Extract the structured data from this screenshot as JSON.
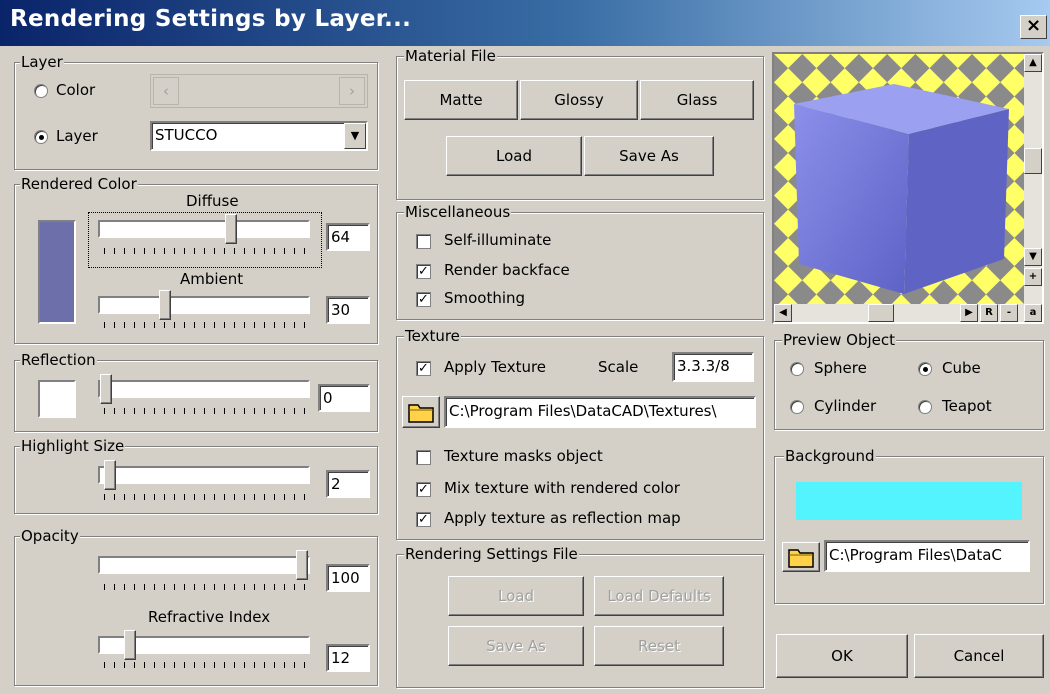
{
  "window": {
    "title": "Rendering Settings by Layer...",
    "close_label": "×"
  },
  "layer": {
    "group_title": "Layer",
    "color_radio": "Color",
    "layer_radio": "Layer",
    "layer_value": "STUCCO",
    "selected": "Layer"
  },
  "rendered_color": {
    "group_title": "Rendered Color",
    "swatch_color": "#6d6fab",
    "diffuse_label": "Diffuse",
    "diffuse_value": "64",
    "ambient_label": "Ambient",
    "ambient_value": "30"
  },
  "reflection": {
    "group_title": "Reflection",
    "swatch_color": "#ffffff",
    "value": "0"
  },
  "highlight": {
    "group_title": "Highlight Size",
    "value": "2"
  },
  "opacity": {
    "group_title": "Opacity",
    "value": "100",
    "refractive_label": "Refractive Index",
    "refractive_value": "12"
  },
  "material": {
    "group_title": "Material File",
    "matte": "Matte",
    "glossy": "Glossy",
    "glass": "Glass",
    "load": "Load",
    "save_as": "Save As"
  },
  "misc": {
    "group_title": "Miscellaneous",
    "self_illuminate": "Self-illuminate",
    "render_backface": "Render backface",
    "smoothing": "Smoothing",
    "checked_self_illuminate": false,
    "checked_render_backface": true,
    "checked_smoothing": true
  },
  "texture": {
    "group_title": "Texture",
    "apply_texture": "Apply Texture",
    "scale_label": "Scale",
    "scale_value": "3.3.3/8",
    "path": "C:\\Program Files\\DataCAD\\Textures\\",
    "masks": "Texture masks object",
    "mix": "Mix texture with rendered color",
    "reflection_map": "Apply texture as reflection map"
  },
  "settings_file": {
    "group_title": "Rendering Settings File",
    "load": "Load",
    "load_defaults": "Load Defaults",
    "save_as": "Save As",
    "reset": "Reset"
  },
  "preview": {
    "btn_r": "R",
    "btn_minus": "-",
    "btn_a": "a",
    "btn_plus": "+",
    "cube_color": "#6e73d6",
    "checker_a": "#ffff66",
    "checker_b": "#8a8a8a"
  },
  "preview_object": {
    "group_title": "Preview Object",
    "sphere": "Sphere",
    "cube": "Cube",
    "cylinder": "Cylinder",
    "teapot": "Teapot",
    "selected": "Cube"
  },
  "background": {
    "group_title": "Background",
    "color": "#54f4ff",
    "path": "C:\\Program Files\\DataC"
  },
  "actions": {
    "ok": "OK",
    "cancel": "Cancel"
  },
  "sliders": {
    "diffuse_level": 0.64,
    "ambient_level": 0.3,
    "reflection_level": 0.0,
    "highlight_level": 0.02,
    "opacity_level": 1.0,
    "refractive_level": 0.12
  }
}
